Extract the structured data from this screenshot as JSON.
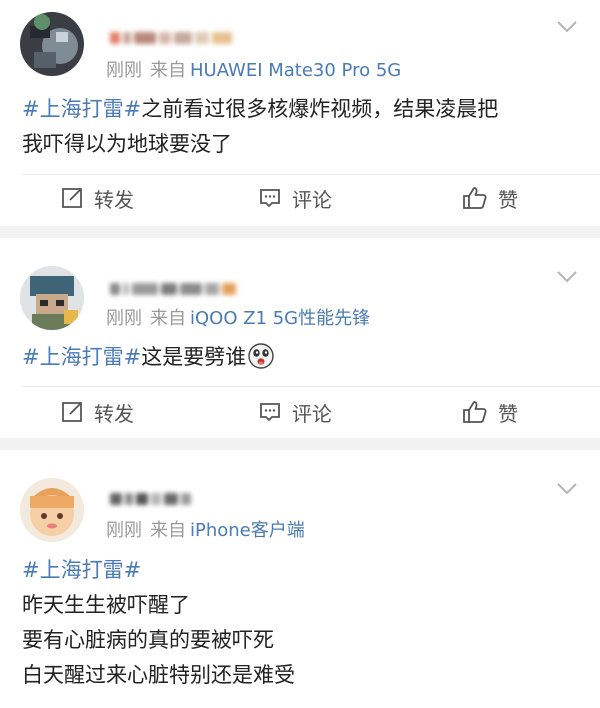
{
  "posts": [
    {
      "time": "刚刚",
      "source_prefix": "来自",
      "device": "HUAWEI Mate30 Pro 5G",
      "topic": "#上海打雷#",
      "text": "之前看过很多核爆炸视频，结果凌晨把\n我吓得以为地球要没了",
      "actions": {
        "repost": "转发",
        "comment": "评论",
        "like": "赞"
      }
    },
    {
      "time": "刚刚",
      "source_prefix": "来自",
      "device": "iQOO Z1 5G性能先锋",
      "topic": "#上海打雷#",
      "text": "这是要劈谁",
      "actions": {
        "repost": "转发",
        "comment": "评论",
        "like": "赞"
      }
    },
    {
      "time": "刚刚",
      "source_prefix": "来自",
      "device": "iPhone客户端",
      "topic": "#上海打雷#",
      "text": "\n昨天生生被吓醒了\n要有心脏病的真的要被吓死\n白天醒过来心脏特别还是难受"
    }
  ],
  "colors": {
    "link": "#4a7bb7",
    "meta": "#9a9a9a",
    "body_text": "#222222",
    "feed_background": "#f2f2f2"
  },
  "icons": {
    "repost": "repost-icon",
    "comment": "comment-icon",
    "like": "thumbs-up-icon",
    "menu": "chevron-down-icon",
    "emoji": "emoji-icon"
  }
}
